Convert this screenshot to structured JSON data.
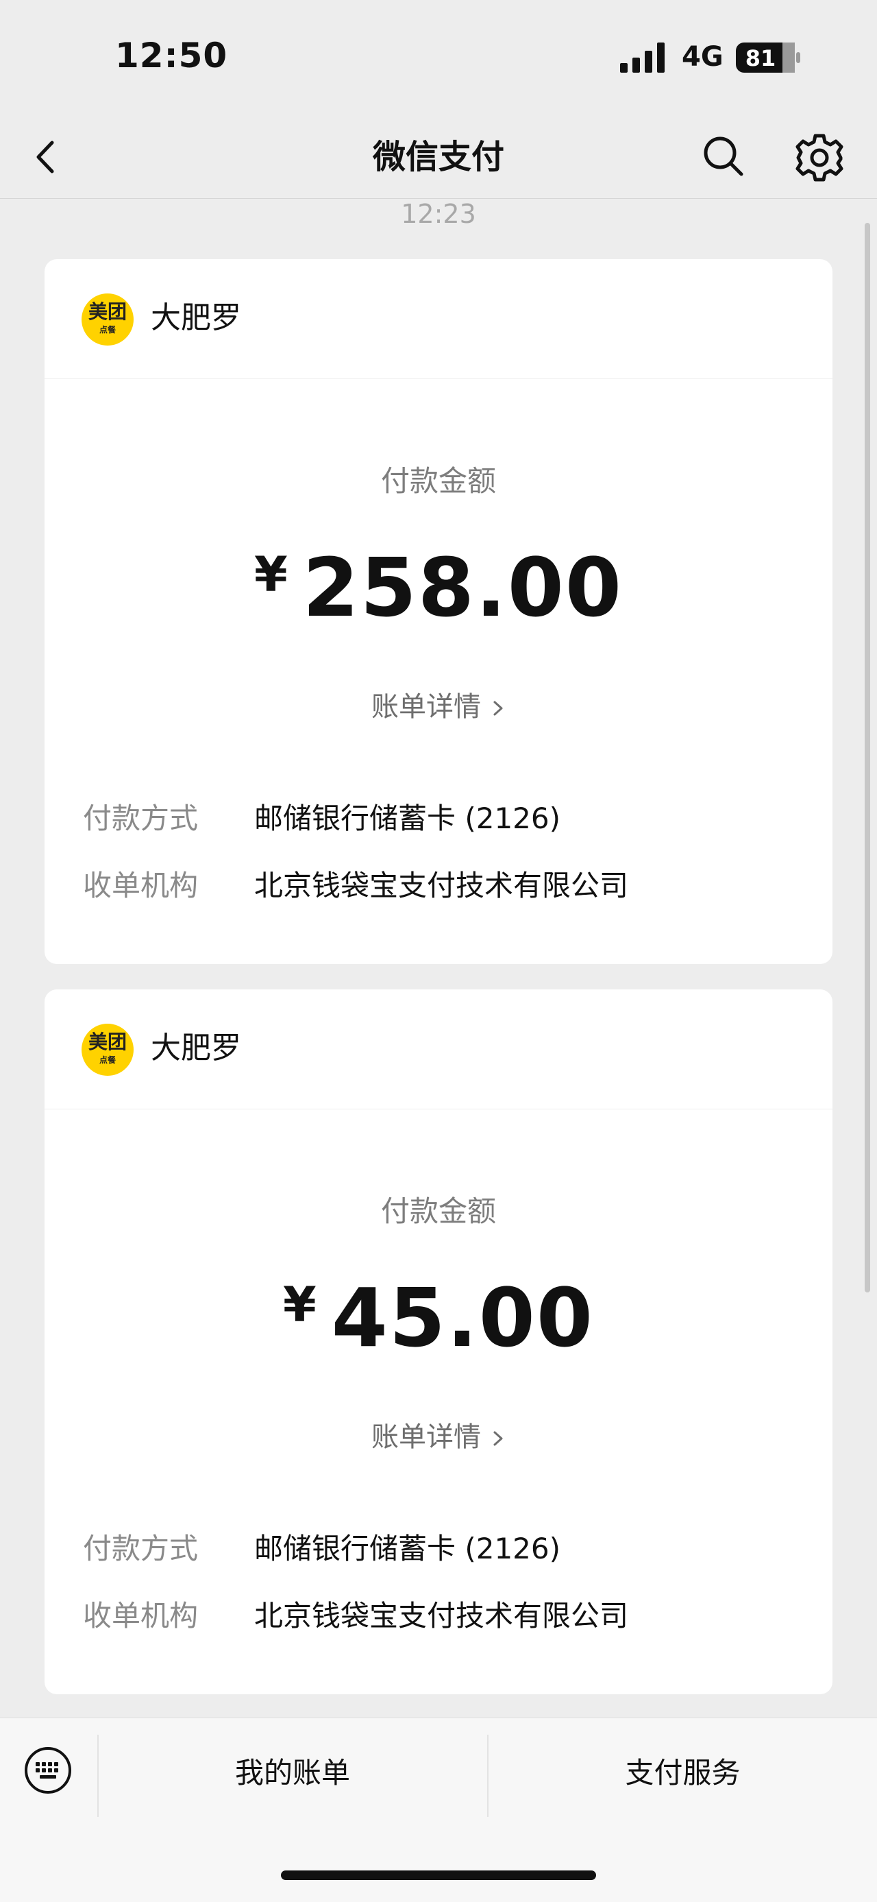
{
  "status_bar": {
    "time": "12:50",
    "network": "4G",
    "battery": "81"
  },
  "nav": {
    "title": "微信支付",
    "back_icon": "chevron-left-icon",
    "search_icon": "search-icon",
    "settings_icon": "gear-icon"
  },
  "timestamp": "12:23",
  "payments": [
    {
      "merchant_logo_main": "美团",
      "merchant_logo_sub": "点餐",
      "merchant": "大肥罗",
      "amount_label": "付款金额",
      "currency": "¥",
      "amount": "258.00",
      "bill_details": "账单详情",
      "method_label": "付款方式",
      "method_value": "邮储银行储蓄卡 (2126)",
      "acquirer_label": "收单机构",
      "acquirer_value": "北京钱袋宝支付技术有限公司"
    },
    {
      "merchant_logo_main": "美团",
      "merchant_logo_sub": "点餐",
      "merchant": "大肥罗",
      "amount_label": "付款金额",
      "currency": "¥",
      "amount": "45.00",
      "bill_details": "账单详情",
      "method_label": "付款方式",
      "method_value": "邮储银行储蓄卡 (2126)",
      "acquirer_label": "收单机构",
      "acquirer_value": "北京钱袋宝支付技术有限公司"
    }
  ],
  "bottom_menu": {
    "keyboard_icon": "keyboard-icon",
    "my_bills": "我的账单",
    "payment_services": "支付服务"
  },
  "colors": {
    "background": "#ededed",
    "card": "#ffffff",
    "meituan_yellow": "#ffd200"
  }
}
